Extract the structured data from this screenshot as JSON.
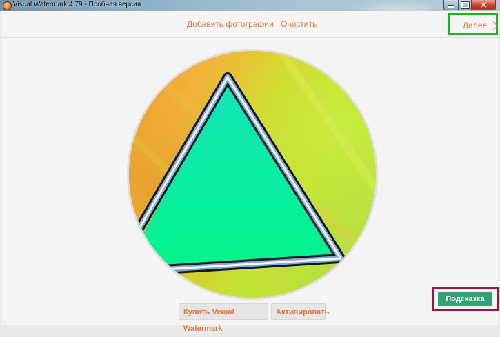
{
  "window": {
    "title": "Visual Watermark 4.79 - Пробная версия",
    "controls": {
      "minimize_icon": "minimize-icon",
      "maximize_icon": "maximize-icon",
      "close_icon": "close-icon",
      "close_glyph": "✕"
    }
  },
  "toolbar": {
    "add_photos": "Добавить фотографии",
    "clear": "Очистить",
    "next": "Далее"
  },
  "photo": {
    "subject": "triangle",
    "colors": {
      "fill": "#00f0a0",
      "background_warm": "#f2a23a",
      "background_green": "#c8e030"
    }
  },
  "bottom": {
    "buy": "Купить Visual Watermark",
    "activate": "Активировать",
    "hint": "Подсказка"
  },
  "colors": {
    "accent": "#e0773c",
    "hint_button": "#2fa374",
    "highlight_green": "#1eb31e",
    "highlight_red": "#9c1346"
  }
}
